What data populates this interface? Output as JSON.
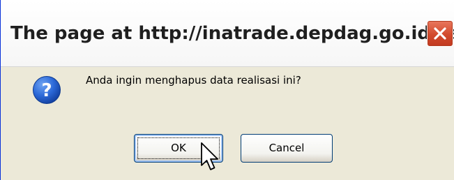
{
  "dialog": {
    "title": "The page at http://inatrade.depdag.go.id says:",
    "message": "Anda ingin menghapus data realisasi ini?",
    "icon": "question-icon",
    "buttons": {
      "ok_label": "OK",
      "cancel_label": "Cancel"
    }
  },
  "colors": {
    "dialog_bg": "#ece9d8",
    "close_red": "#d24a2d",
    "question_blue": "#1d5fd1",
    "button_border": "#003c74"
  }
}
